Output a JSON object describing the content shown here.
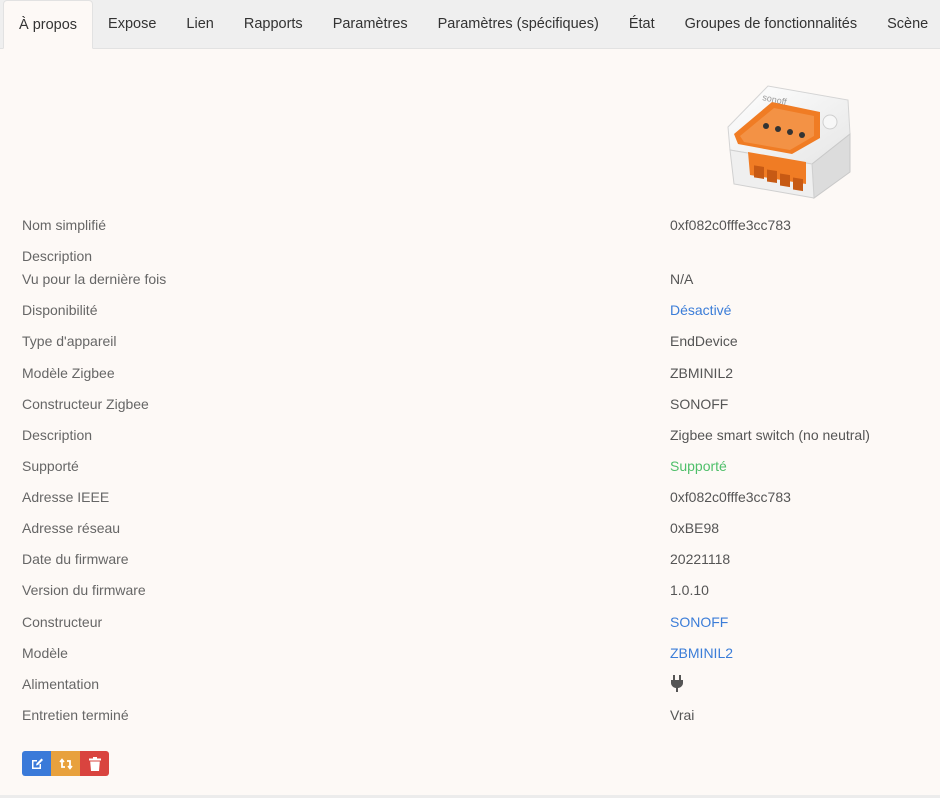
{
  "tabs": [
    {
      "label": "À propos",
      "active": true
    },
    {
      "label": "Expose"
    },
    {
      "label": "Lien"
    },
    {
      "label": "Rapports"
    },
    {
      "label": "Paramètres"
    },
    {
      "label": "Paramètres (spécifiques)"
    },
    {
      "label": "État"
    },
    {
      "label": "Groupes de fonctionnalités"
    },
    {
      "label": "Scène"
    }
  ],
  "device_image": {
    "brand_text": "sonoff",
    "icon": "device-photo"
  },
  "details": [
    {
      "label": "Nom simplifié",
      "value": "0xf082c0fffe3cc783"
    },
    {
      "label": "Description",
      "value": ""
    },
    {
      "label": "Vu pour la dernière fois",
      "value": "N/A"
    },
    {
      "label": "Disponibilité",
      "value": "Désactivé"
    },
    {
      "label": "Type d'appareil",
      "value": "EndDevice"
    },
    {
      "label": "Modèle Zigbee",
      "value": "ZBMINIL2"
    },
    {
      "label": "Constructeur Zigbee",
      "value": "SONOFF"
    },
    {
      "label": "Description",
      "value": "Zigbee smart switch (no neutral)"
    },
    {
      "label": "Supporté",
      "value": "Supporté"
    },
    {
      "label": "Adresse IEEE",
      "value": "0xf082c0fffe3cc783"
    },
    {
      "label": "Adresse réseau",
      "value": "0xBE98"
    },
    {
      "label": "Date du firmware",
      "value": "20221118"
    },
    {
      "label": "Version du firmware",
      "value": "1.0.10"
    },
    {
      "label": "Constructeur",
      "value": "SONOFF"
    },
    {
      "label": "Modèle",
      "value": "ZBMINIL2"
    },
    {
      "label": "Alimentation",
      "value": "",
      "icon": "plug-icon"
    },
    {
      "label": "Entretien terminé",
      "value": "Vrai"
    }
  ],
  "actions": [
    {
      "name": "edit",
      "icon": "edit-icon",
      "color": "#3a7ad9"
    },
    {
      "name": "reconfigure",
      "icon": "refresh-icon",
      "color": "#e8a13d"
    },
    {
      "name": "delete",
      "icon": "trash-icon",
      "color": "#d9443f"
    }
  ],
  "colors": {
    "link": "#3b7dd8",
    "success": "#4fbf6a",
    "background": "#fdf9f6"
  }
}
